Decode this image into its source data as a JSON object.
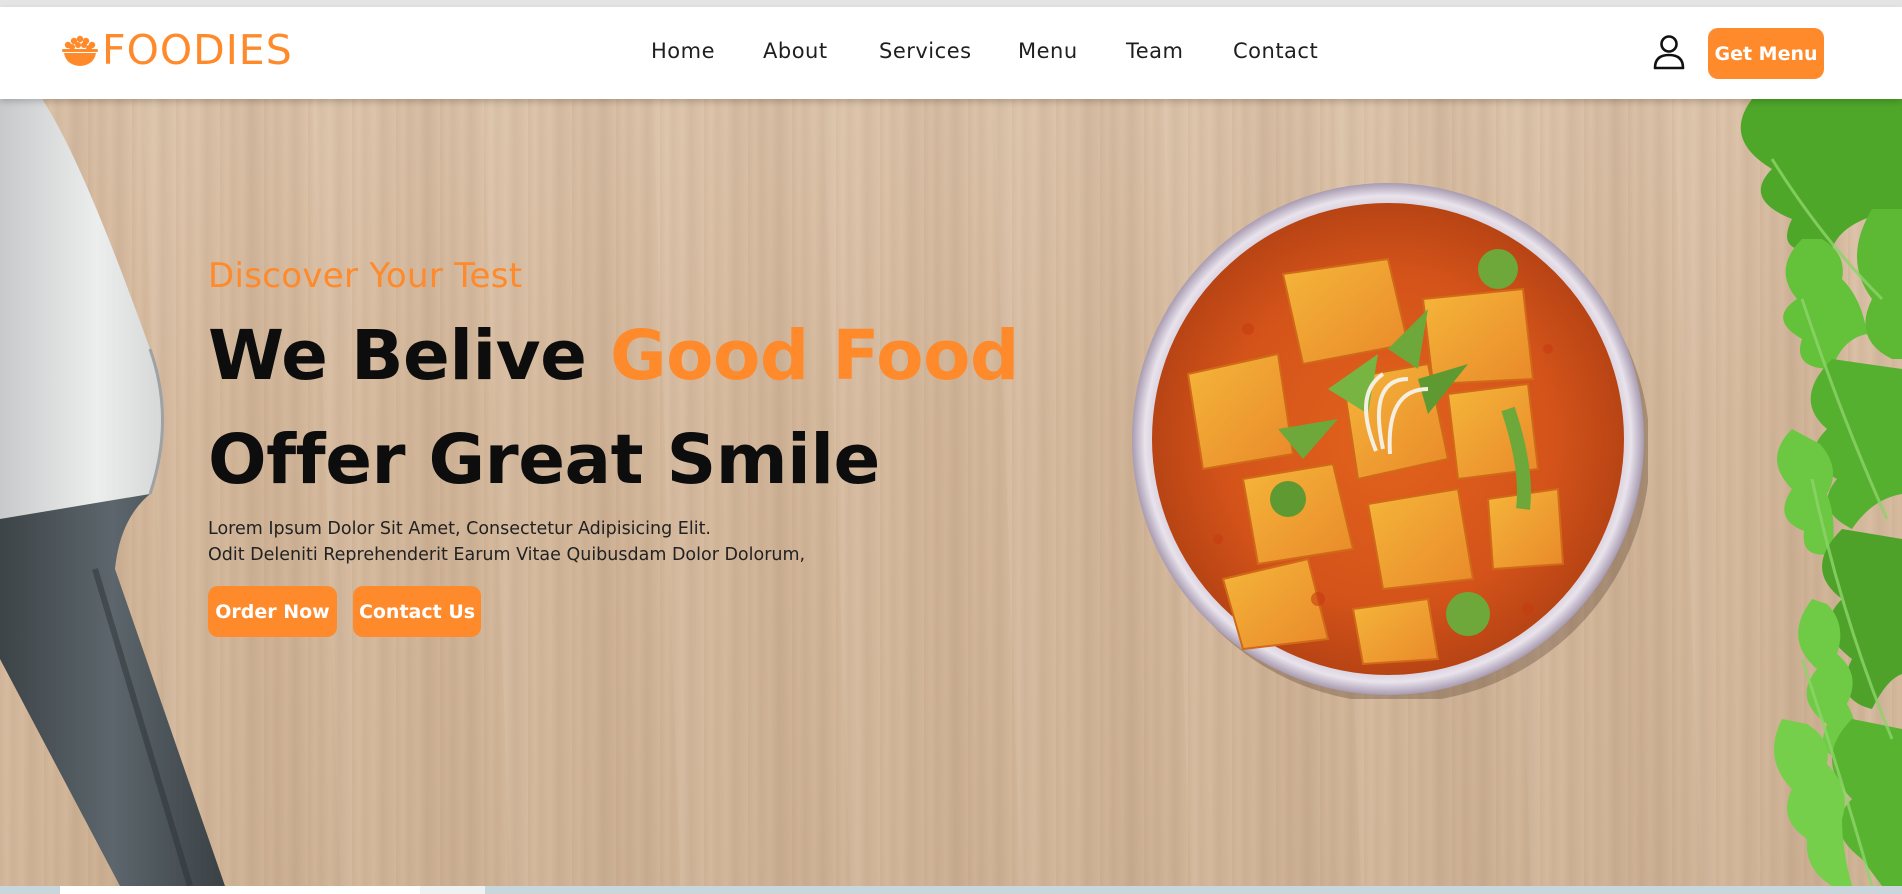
{
  "brand": {
    "name": "FOODIES",
    "icon": "bowl-icon",
    "accent_color": "#fe8a2b"
  },
  "nav": {
    "items": [
      {
        "label": "Home"
      },
      {
        "label": "About"
      },
      {
        "label": "Services"
      },
      {
        "label": "Menu"
      },
      {
        "label": "Team"
      },
      {
        "label": "Contact"
      }
    ],
    "user_icon": "user-icon",
    "get_menu_label": "Get Menu"
  },
  "hero": {
    "kicker": "Discover Your Test",
    "headline_part1": "We Belive ",
    "headline_accent": "Good Food",
    "headline_line2": "Offer Great Smile",
    "description_line1": "Lorem Ipsum Dolor Sit Amet, Consectetur Adipisicing Elit.",
    "description_line2": "Odit Deleniti Reprehenderit Earum Vitae Quibusdam Dolor Dolorum,",
    "order_now_label": "Order Now",
    "contact_us_label": "Contact Us",
    "dish_image": "curry-bowl-image"
  }
}
